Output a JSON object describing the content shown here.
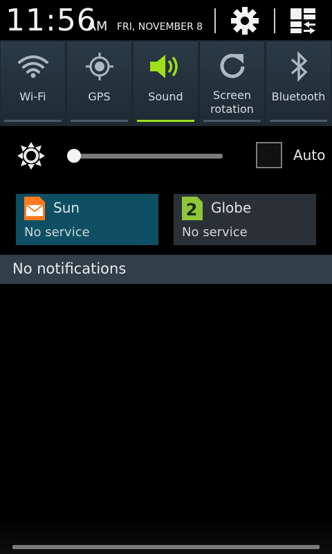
{
  "status": {
    "time": "11:56",
    "ampm": "AM",
    "date": "FRI, NOVEMBER 8"
  },
  "toggles": [
    {
      "label": "Wi-Fi",
      "icon": "wifi-icon",
      "on": false
    },
    {
      "label": "GPS",
      "icon": "gps-icon",
      "on": false
    },
    {
      "label": "Sound",
      "icon": "sound-icon",
      "on": true
    },
    {
      "label": "Screen rotation",
      "line1": "Screen",
      "line2": "rotation",
      "icon": "rotation-icon",
      "on": false
    },
    {
      "label": "Bluetooth",
      "icon": "bluetooth-icon",
      "on": false
    }
  ],
  "brightness": {
    "level": 0.0,
    "auto_label": "Auto",
    "auto_checked": false
  },
  "sims": [
    {
      "name": "Sun",
      "status": "No service",
      "icon": "sim-mail-icon",
      "active": true
    },
    {
      "name": "Globe",
      "status": "No service",
      "icon": "sim-2-icon",
      "active": false
    }
  ],
  "notifications": {
    "header": "No notifications"
  },
  "colors": {
    "accent_on": "#9ee01a",
    "sim_active_bg": "#0f4f63",
    "sim_inactive_bg": "#2a3136",
    "sim1_icon": "#ff7a1e",
    "sim2_icon": "#8fc63a"
  }
}
